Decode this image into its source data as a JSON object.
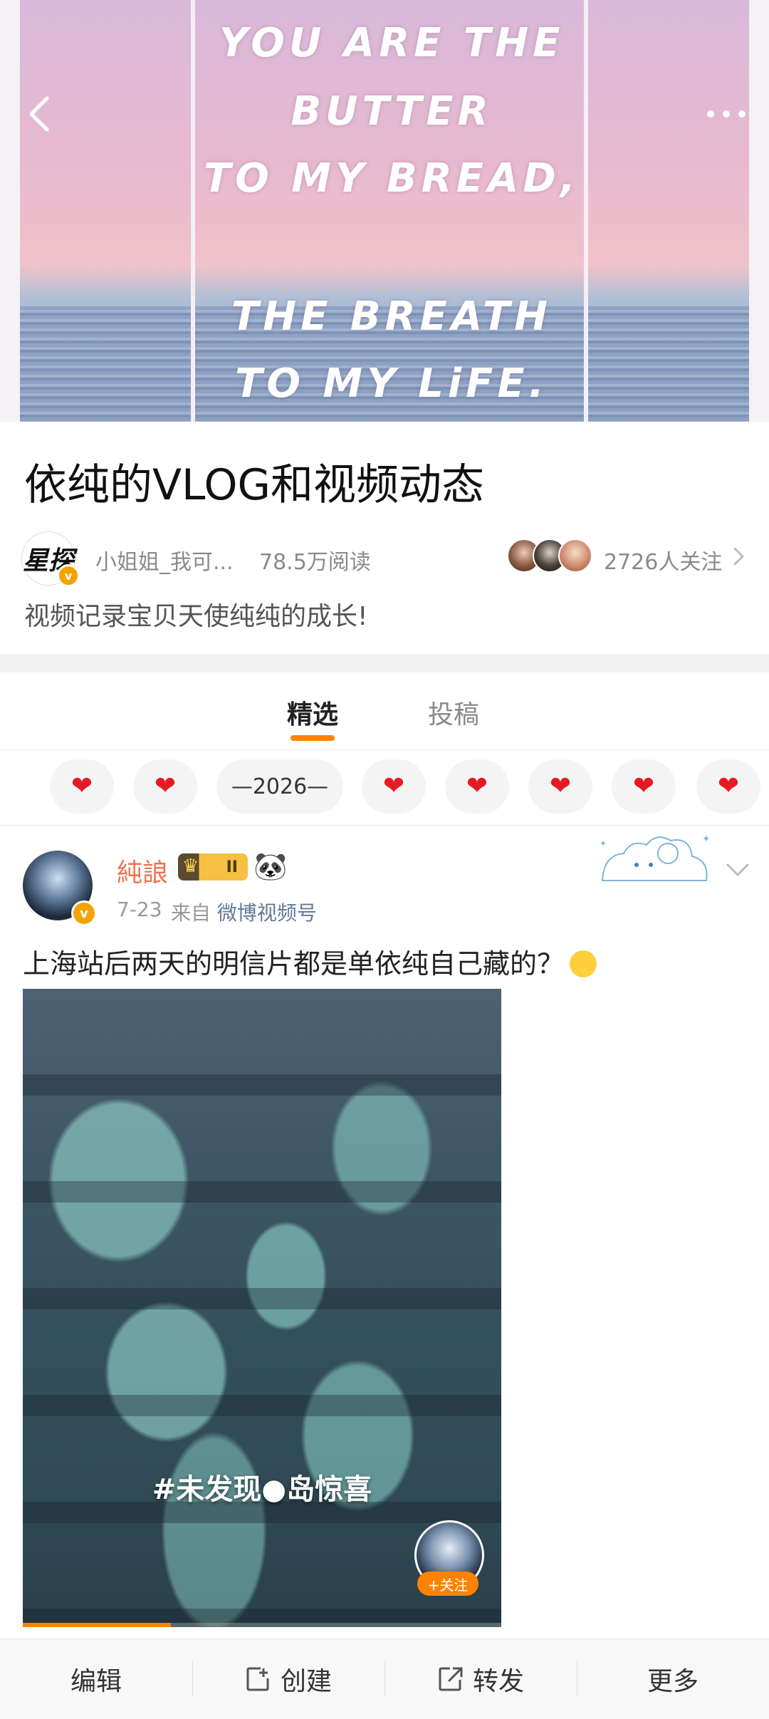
{
  "banner": {
    "quote_lines": [
      "YOU ARE THE",
      "BUTTER",
      "TO MY BREAD,",
      "THE BREATH",
      "TO MY LiFE."
    ]
  },
  "nav": {
    "back_icon": "chevron-left-icon",
    "more_icon": "more-dots-icon"
  },
  "topic": {
    "title": "依纯的VLOG和视频动态",
    "host_logo_text": "星探",
    "host_name": "小姐姐_我可...",
    "reads": "78.5万阅读",
    "followers": "2726人关注",
    "description": "视频记录宝贝天使纯纯的成长!"
  },
  "tabs": [
    {
      "label": "精选",
      "active": true
    },
    {
      "label": "投稿",
      "active": false
    }
  ],
  "chips": [
    "❤",
    "❤",
    "—2026—",
    "❤",
    "❤",
    "❤",
    "❤",
    "❤"
  ],
  "post": {
    "username": "純誏",
    "level_badge": "II",
    "time": "7-23",
    "source_prefix": "来自",
    "source_name": "微博视频号",
    "text": "上海站后两天的明信片都是单依纯自己藏的？",
    "video_caption": "#未发现●岛惊喜",
    "follow_label": "+关注",
    "video_progress": 0.31
  },
  "bottom_bar": {
    "edit": "编辑",
    "create": "创建",
    "share": "转发",
    "more": "更多"
  },
  "colors": {
    "accent": "#ff8200",
    "username": "#eb7350",
    "heart": "#e51b23"
  }
}
